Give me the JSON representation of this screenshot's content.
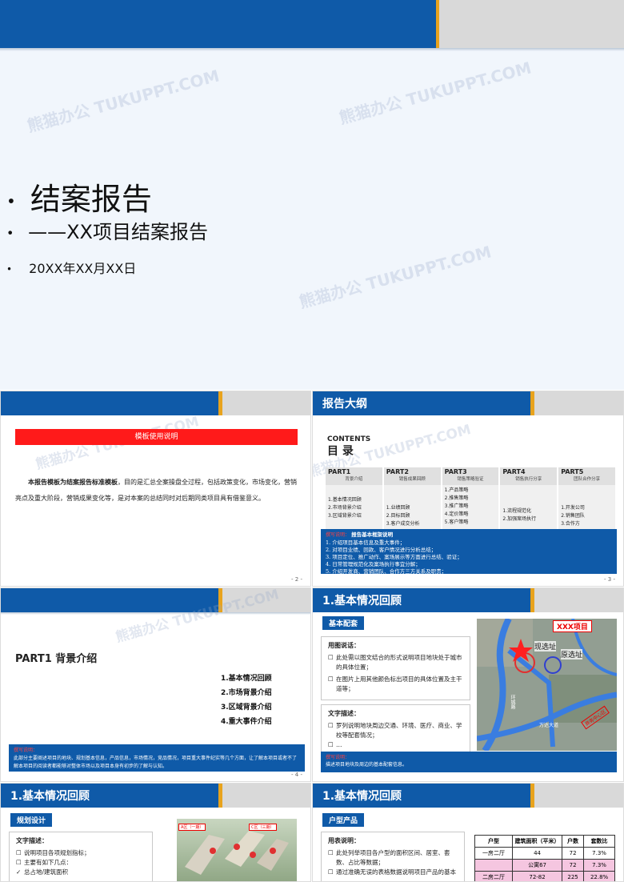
{
  "cover": {
    "bullet1": "结案报告",
    "bullet2": "——XX项目结案报告",
    "bullet3": "20XX年XX月XX日",
    "watermark": "熊猫办公 TUKUPPT.COM"
  },
  "slide2": {
    "red_bar": "模板使用说明",
    "body_bold": "本报告模板为结案报告标准模板",
    "body_rest": "，目的是汇总全案操盘全过程，包括政策变化，市场变化，营销亮点及重大阶段，营销成果变化等，是对本案的总结同时对后期同类项目具有借鉴意义。",
    "page": "- 2 -"
  },
  "slide3": {
    "title": "报告大纲",
    "contents_en": "CONTENTS",
    "contents_cn": "目 录",
    "parts": [
      {
        "part": "PART1",
        "name": "背景介绍",
        "items": [
          "1.基本情况回顾",
          "2.市场背景介绍",
          "3.区域背景介绍",
          "4.重大事件介绍"
        ]
      },
      {
        "part": "PART2",
        "name": "销售成果回顾",
        "items": [
          "1.业绩回顾",
          "2.目标回顾",
          "3.客户成交分析"
        ]
      },
      {
        "part": "PART3",
        "name": "销售策略验证",
        "items": [
          "1.产品策略",
          "2.推售策略",
          "3.推广策略",
          "4.定价策略",
          "5.客户策略"
        ]
      },
      {
        "part": "PART4",
        "name": "销售执行分享",
        "items": [
          "1.流程规范化",
          "2.加强案场执行"
        ]
      },
      {
        "part": "PART5",
        "name": "团队合作分享",
        "items": [
          "1.开发公司",
          "2.销售团队",
          "3.合作方"
        ]
      }
    ],
    "note_label": "撰写说明：",
    "note_title": "报告基本框架说明",
    "notes": [
      "1.    介绍项目基本信息及重大事件；",
      "2.    对项目业绩、回款、客户情况进行分析总结；",
      "3.    项目定位、推广动作、案场展示等方面进行总结、验证；",
      "4.    日常管理规范化及案场执行事宜分解；",
      "5.    介绍开发商、营销团队、合作方三方关系及职责；"
    ],
    "page": "- 3 -"
  },
  "slide4": {
    "part_title": "PART1  背景介绍",
    "items": [
      "1.基本情况回顾",
      "2.市场背景介绍",
      "3.区域背景介绍",
      "4.重大事件介绍"
    ],
    "note_label": "撰写说明：",
    "note_text": "此部分主要阐述项目的地块、规划基本信息，产品信息，市场情况，竞品情况，项目重大事件纪实等几个方面，让了解本项目或者不了解本项目的阅读者都能够对整体市场以及项目本身有初步的了解与认知。",
    "page": "- 4 -"
  },
  "slide5": {
    "title": "1.基本情况回顾",
    "tag": "基本配套",
    "h1": "用图说话：",
    "b1": "此处需以图文结合的形式说明项目地块处于城市的具体位置；",
    "b2": "在图片上用其他颜色标出项目的具体位置及主干道等；",
    "h2": "文字描述：",
    "b3": "罗列说明地块周边交通、环境、医疗、商业、学校等配套情况；",
    "b4": "…",
    "map_label_xxx": "XXX项目",
    "map_label_now": "现选址",
    "map_label_old": "原选址",
    "map_road1": "环城路",
    "map_road2": "万达大道",
    "map_red": "商务中心区",
    "note_label": "撰写说明：",
    "note_text": "描述项目地块及周边的基本配套信息。"
  },
  "slide6": {
    "title": "1.基本情况回顾",
    "tag": "规划设计",
    "h1": "文字描述：",
    "b1": "说明项目各项规划指标；",
    "b2": "主要有如下几点：",
    "b3": "总占地/建筑面积",
    "label1": "A区（一期）",
    "label2": "C区（三期）"
  },
  "slide7": {
    "title": "1.基本情况回顾",
    "tag": "户型产品",
    "h1": "用表说明：",
    "b1": "此处列举项目各户型的面积区间、居室、套数、占比等数据；",
    "b2": "通过准确无误的表格数据说明项目产品的基本",
    "table_headers": [
      "户型",
      "建筑面积（平米）",
      "户数",
      "套数比"
    ],
    "rows": [
      [
        "一房二厅",
        "44",
        "72",
        "7.3%"
      ],
      [
        "",
        "公寓67",
        "72",
        "7.3%"
      ],
      [
        "二房二厅",
        "72-82",
        "225",
        "22.8%"
      ]
    ],
    "stamp": "示例"
  }
}
